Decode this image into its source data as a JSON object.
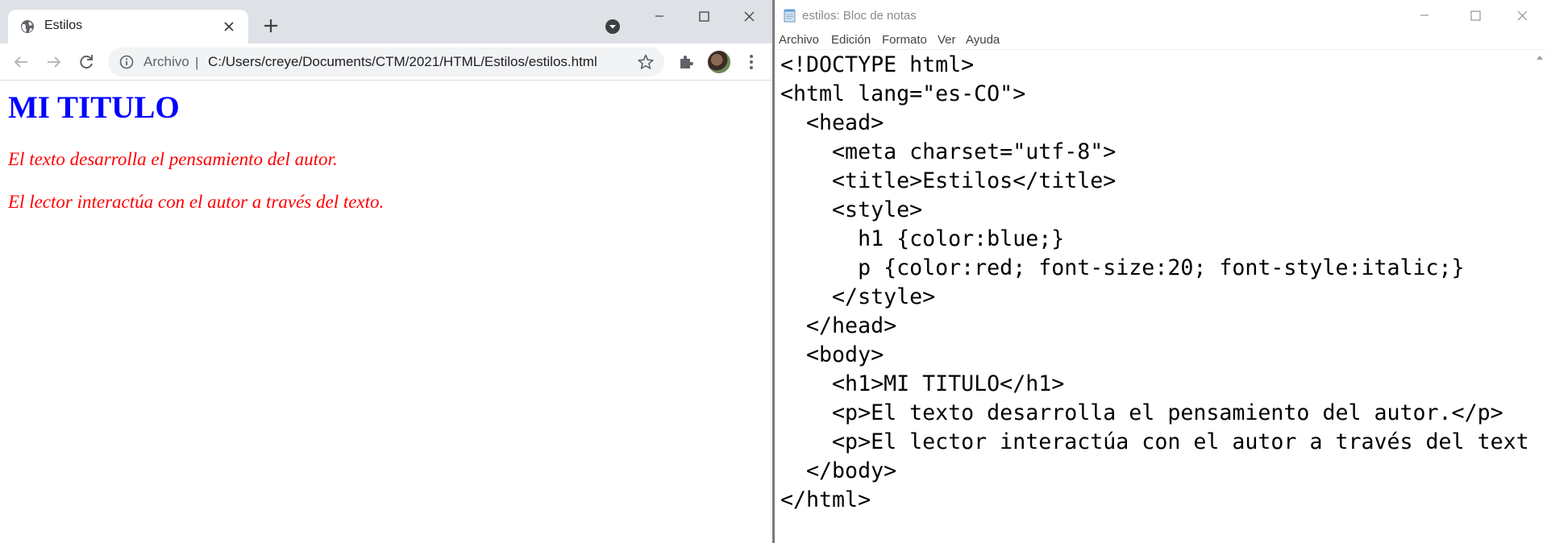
{
  "chrome": {
    "tab": {
      "title": "Estilos",
      "favicon": "globe-icon",
      "close_icon": "close-icon"
    },
    "new_tab_icon": "plus-icon",
    "tab_search_icon": "chevron-down-circle-icon",
    "window_controls": {
      "minimize": "minimize-icon",
      "maximize": "maximize-icon",
      "close": "close-icon"
    },
    "toolbar": {
      "back_icon": "arrow-left-icon",
      "forward_icon": "arrow-right-icon",
      "reload_icon": "reload-icon",
      "omnibox": {
        "site_info_icon": "info-icon",
        "scheme_label": "Archivo",
        "separator": "|",
        "url": "C:/Users/creye/Documents/CTM/2021/HTML/Estilos/estilos.html",
        "bookmark_icon": "star-icon"
      },
      "extensions_icon": "puzzle-icon",
      "profile_icon": "avatar",
      "menu_icon": "kebab-menu-icon"
    },
    "page": {
      "h1": "MI TITULO",
      "paragraphs": [
        "El texto desarrolla el pensamiento del autor.",
        "El lector interactúa con el autor a través del texto."
      ],
      "colors": {
        "h1": "#0000ff",
        "p": "#ff0000"
      }
    }
  },
  "notepad": {
    "title": "estilos: Bloc de notas",
    "app_icon": "notepad-icon",
    "window_controls": {
      "minimize": "minimize-icon",
      "maximize": "maximize-icon",
      "close": "close-icon"
    },
    "menu": [
      "Archivo",
      "Edición",
      "Formato",
      "Ver",
      "Ayuda"
    ],
    "lines": [
      "<!DOCTYPE html>",
      "<html lang=\"es-CO\">",
      "  <head>",
      "    <meta charset=\"utf-8\">",
      "    <title>Estilos</title>",
      "    <style>",
      "      h1 {color:blue;}",
      "      p {color:red; font-size:20; font-style:italic;}",
      "    </style>",
      "  </head>",
      "  <body>",
      "    <h1>MI TITULO</h1>",
      "    <p>El texto desarrolla el pensamiento del autor.</p>",
      "    <p>El lector interactúa con el autor a través del text",
      "  </body>",
      "</html>"
    ]
  }
}
